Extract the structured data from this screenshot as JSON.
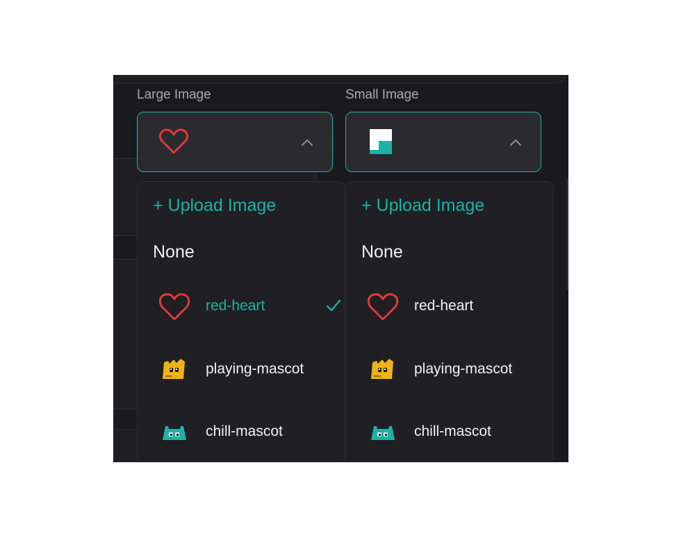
{
  "colors": {
    "accent": "#1bb3a4",
    "panel": "#1a1a1e",
    "heart": "#e03a3a"
  },
  "large_image": {
    "label": "Large Image",
    "selected_icon": "red-heart-icon",
    "menu": {
      "upload_label": "+ Upload Image",
      "none_label": "None",
      "options": [
        {
          "label": "red-heart",
          "icon": "red-heart-icon",
          "selected": true
        },
        {
          "label": "playing-mascot",
          "icon": "playing-mascot-icon",
          "selected": false
        },
        {
          "label": "chill-mascot",
          "icon": "chill-mascot-icon",
          "selected": false
        }
      ]
    }
  },
  "small_image": {
    "label": "Small Image",
    "selected_icon": "teal-square-icon",
    "menu": {
      "upload_label": "+ Upload Image",
      "none_label": "None",
      "options": [
        {
          "label": "red-heart",
          "icon": "red-heart-icon",
          "selected": false
        },
        {
          "label": "playing-mascot",
          "icon": "playing-mascot-icon",
          "selected": false
        },
        {
          "label": "chill-mascot",
          "icon": "chill-mascot-icon",
          "selected": false
        }
      ]
    }
  }
}
